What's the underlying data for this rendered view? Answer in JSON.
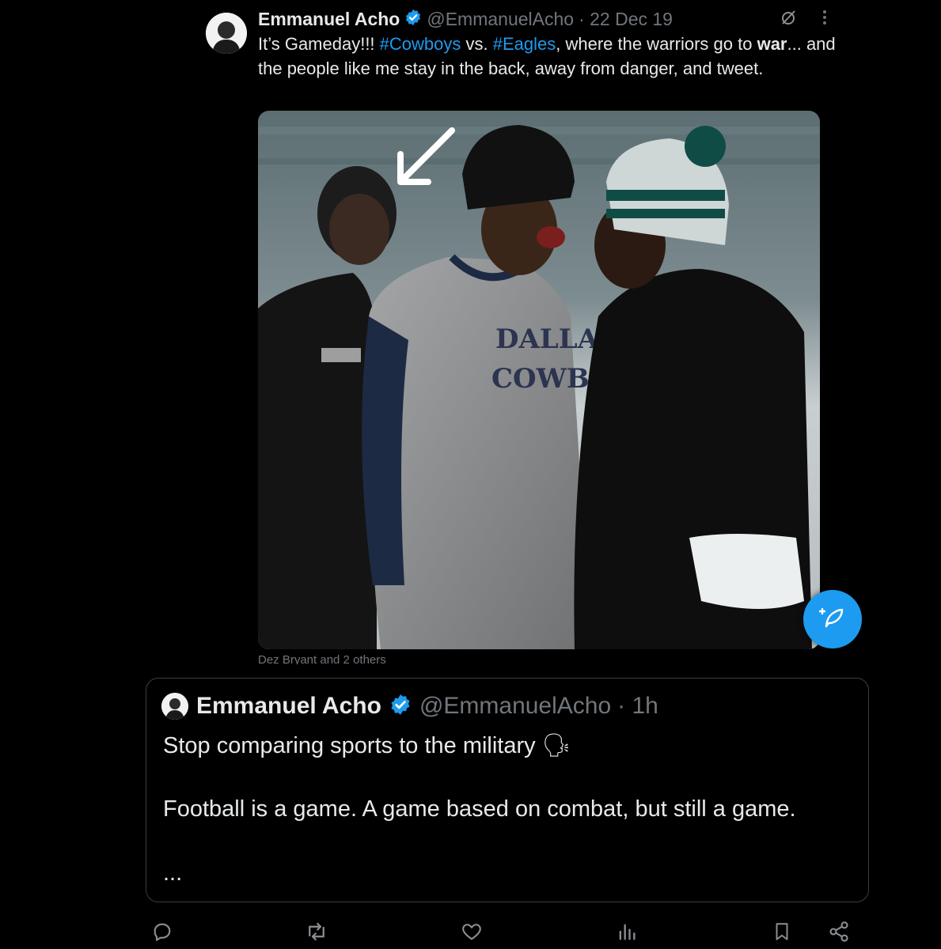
{
  "tweet": {
    "author_name": "Emmanuel Acho",
    "author_handle": "@EmmanuelAcho",
    "date": "· 22 Dec 19",
    "text_start": "It’s Gameday!!! ",
    "hashtag1": "#Cowboys",
    "text_mid": " vs. ",
    "hashtag2": "#Eagles",
    "text_after": ", where the warriors go to ",
    "text_bold": "war",
    "text_end": "... and the people like me stay in the back, away from danger, and tweet.",
    "tagged_people": "Dez Bryant and 2 others",
    "photo": {
      "jersey_text_line1": "DALLAS",
      "jersey_text_line2": "COWBOYS"
    }
  },
  "quote": {
    "author_name": "Emmanuel Acho",
    "author_handle": "@EmmanuelAcho",
    "time": "· 1h",
    "line1": "Stop comparing sports to the military 🗣",
    "line2": "Football is a game. A game based on combat, but still a game.",
    "more": "..."
  },
  "icons": {
    "top": [
      "grok-icon",
      "more-icon"
    ],
    "actions": [
      "reply-icon",
      "retweet-icon",
      "like-icon",
      "views-icon",
      "bookmark-icon",
      "share-icon"
    ],
    "fab": "compose-icon"
  },
  "colors": {
    "accent": "#1d9bf0",
    "background": "#000000",
    "text": "#e7e9ea",
    "muted": "#71767b"
  }
}
